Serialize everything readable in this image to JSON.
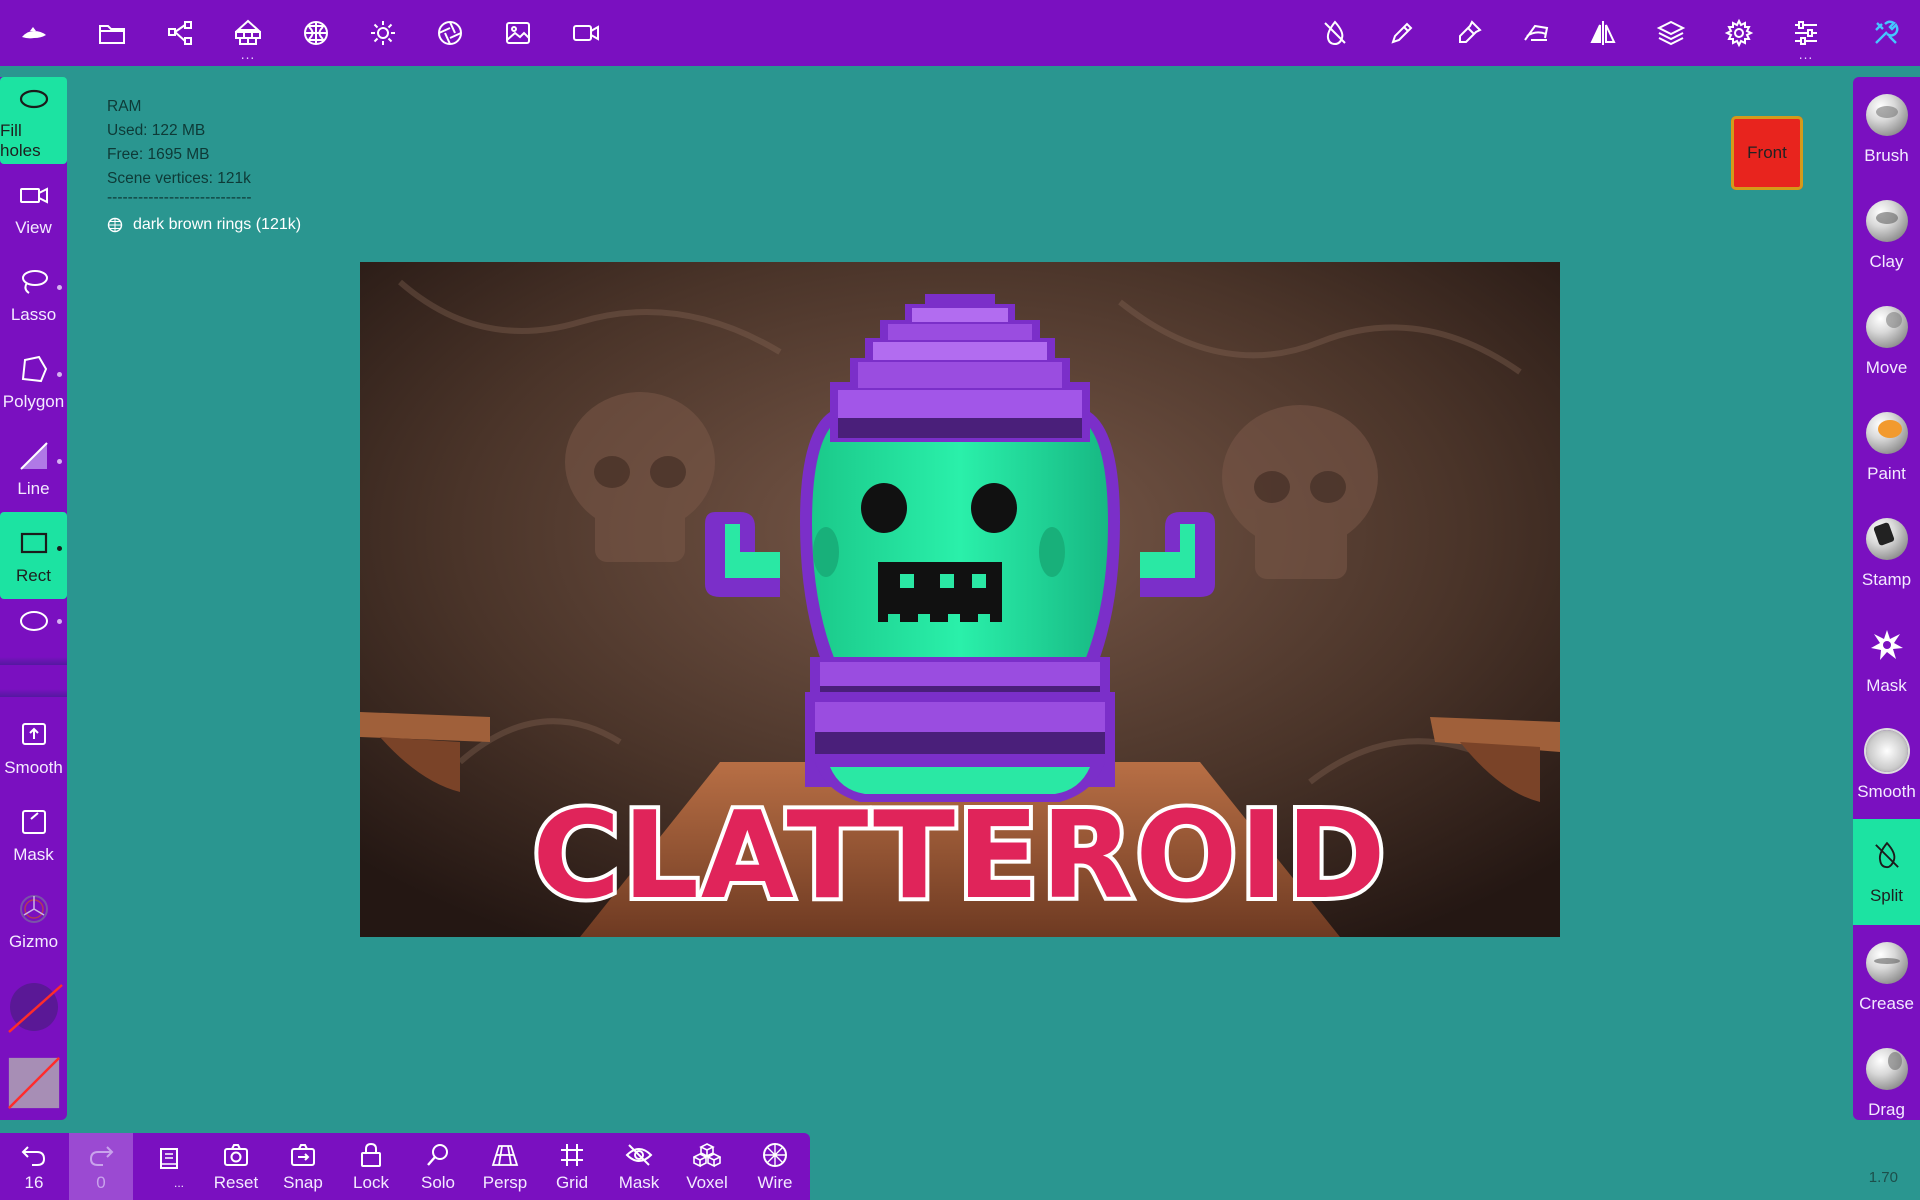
{
  "topbar": {
    "left_icons": [
      "app-logo-icon",
      "folder-icon",
      "share-icon",
      "scene-hierarchy-icon",
      "sphere-grid-icon",
      "sun-icon",
      "aperture-icon",
      "image-icon",
      "video-camera-icon"
    ],
    "right_icons": [
      "no-pressure-icon",
      "pencil-icon",
      "dropper-icon",
      "stroke-icon",
      "symmetry-icon",
      "layers-icon",
      "gear-icon",
      "sliders-icon",
      "tools-icon"
    ]
  },
  "ram": {
    "title": "RAM",
    "used": "Used: 122 MB",
    "free": "Free: 1695 MB",
    "vertices": "Scene vertices: 121k",
    "separator": "----------------------------"
  },
  "scene": {
    "object_label": "dark brown rings (121k)"
  },
  "front_cube": {
    "label": "Front"
  },
  "left_tools": [
    {
      "label": "Fill holes",
      "icon": "ellipse-outline-icon",
      "active": true
    },
    {
      "label": "View",
      "icon": "camera-icon",
      "active": false
    },
    {
      "label": "Lasso",
      "icon": "lasso-icon",
      "active": false
    },
    {
      "label": "Polygon",
      "icon": "polygon-icon",
      "active": false
    },
    {
      "label": "Line",
      "icon": "line-icon",
      "active": false
    },
    {
      "label": "Rect",
      "icon": "rectangle-icon",
      "active": true
    },
    {
      "label": "",
      "icon": "ellipse-icon",
      "active": false
    }
  ],
  "left_tools_lower": [
    {
      "label": "Smooth",
      "icon": "smooth-square-icon"
    },
    {
      "label": "Mask",
      "icon": "mask-square-icon"
    },
    {
      "label": "Gizmo",
      "icon": "gizmo-icon"
    }
  ],
  "right_tools": [
    {
      "label": "Brush",
      "active": false
    },
    {
      "label": "Clay",
      "active": false
    },
    {
      "label": "Move",
      "active": false
    },
    {
      "label": "Paint",
      "active": false
    },
    {
      "label": "Stamp",
      "active": false
    },
    {
      "label": "Mask",
      "active": false
    },
    {
      "label": "Smooth",
      "active": false
    },
    {
      "label": "Split",
      "active": true
    },
    {
      "label": "Crease",
      "active": false
    },
    {
      "label": "Drag",
      "active": false
    }
  ],
  "bottombar": {
    "undo": "16",
    "redo": "0",
    "more": "...",
    "items": [
      "Reset",
      "Snap",
      "Lock",
      "Solo",
      "Persp",
      "Grid",
      "Mask",
      "Voxel",
      "Wire"
    ]
  },
  "reference_image": {
    "title_text": "CLATTEROID",
    "colors": {
      "title_fill": "#e0245a",
      "character_body": "#22e8a0",
      "character_bands": "#7b2fc9"
    }
  },
  "version": "1.70",
  "colors": {
    "toolbar": "#7a10c0",
    "accent": "#1ce3a2",
    "viewport_bg": "#2a9690"
  }
}
